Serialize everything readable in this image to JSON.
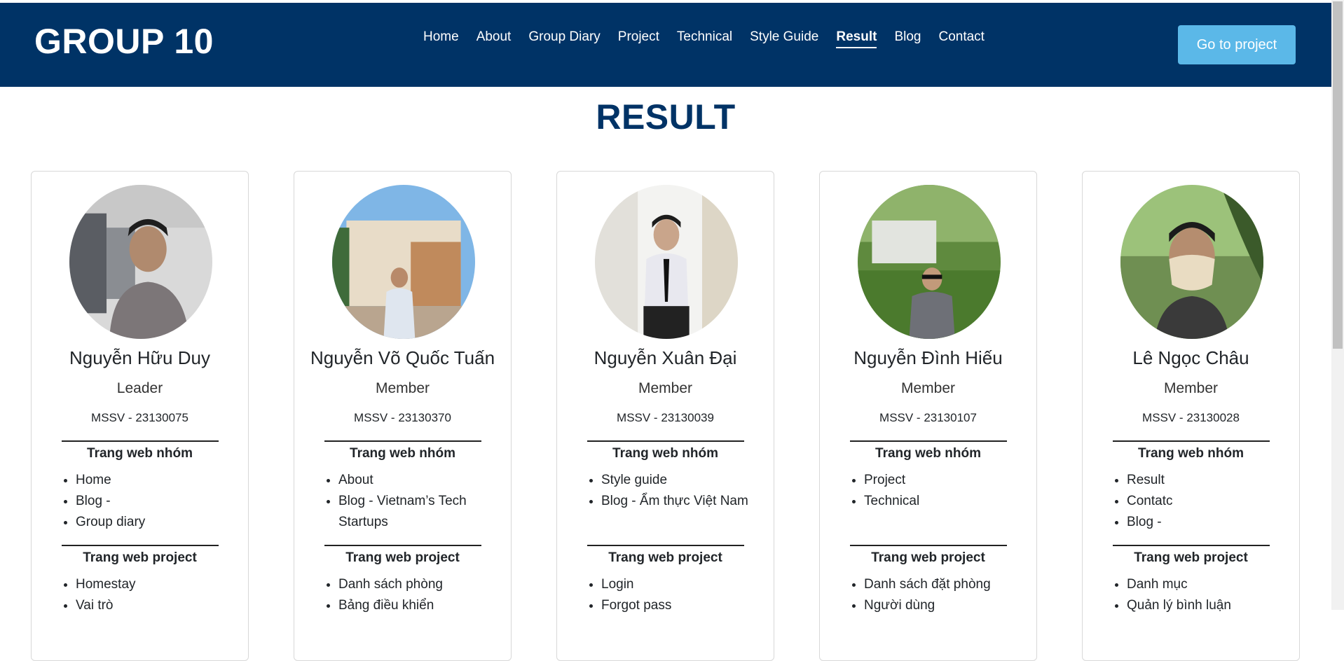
{
  "navbar": {
    "brand": "GROUP 10",
    "links": [
      {
        "label": "Home",
        "active": false
      },
      {
        "label": "About",
        "active": false
      },
      {
        "label": "Group Diary",
        "active": false
      },
      {
        "label": "Project",
        "active": false
      },
      {
        "label": "Technical",
        "active": false
      },
      {
        "label": "Style Guide",
        "active": false
      },
      {
        "label": "Result",
        "active": true
      },
      {
        "label": "Blog",
        "active": false
      },
      {
        "label": "Contact",
        "active": false
      }
    ],
    "cta_label": "Go to project"
  },
  "page": {
    "title": "RESULT"
  },
  "section_labels": {
    "group_site": "Trang web nhóm",
    "project_site": "Trang web project"
  },
  "members": [
    {
      "name": "Nguyễn Hữu Duy",
      "role": "Leader",
      "mssv": "MSSV - 23130075",
      "group_items": [
        "Home",
        "Blog -",
        "Group diary"
      ],
      "project_items": [
        "Homestay",
        "Vai trò"
      ]
    },
    {
      "name": "Nguyễn Võ Quốc Tuấn",
      "role": "Member",
      "mssv": "MSSV - 23130370",
      "group_items": [
        "About",
        "Blog - Vietnam’s Tech Startups"
      ],
      "project_items": [
        "Danh sách phòng",
        "Bảng điều khiển"
      ]
    },
    {
      "name": "Nguyễn Xuân Đại",
      "role": "Member",
      "mssv": "MSSV - 23130039",
      "group_items": [
        "Style guide",
        "Blog - Ẩm thực Việt Nam"
      ],
      "project_items": [
        "Login",
        "Forgot pass"
      ]
    },
    {
      "name": "Nguyễn Đình Hiếu",
      "role": "Member",
      "mssv": "MSSV - 23130107",
      "group_items": [
        "Project",
        "Technical"
      ],
      "project_items": [
        "Danh sách đặt phòng",
        "Người dùng"
      ]
    },
    {
      "name": "Lê Ngọc Châu",
      "role": "Member",
      "mssv": "MSSV - 23130028",
      "group_items": [
        "Result",
        "Contatc",
        "Blog -"
      ],
      "project_items": [
        "Danh mục",
        "Quản lý bình luận"
      ]
    }
  ],
  "colors": {
    "navbar_bg": "#003366",
    "cta_bg": "#5bb8e8",
    "title": "#003366"
  }
}
